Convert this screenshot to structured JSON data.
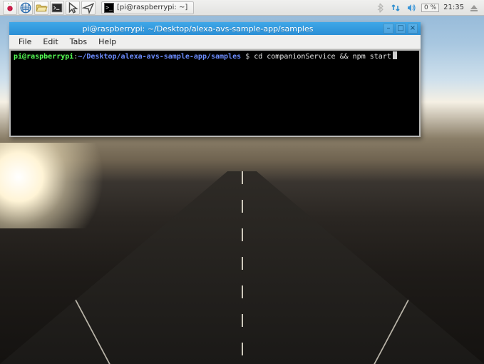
{
  "taskbar": {
    "task_label": "[pi@raspberrypi: ~]",
    "cpu_text": "0 %",
    "clock": "21:35"
  },
  "window": {
    "title": "pi@raspberrypi: ~/Desktop/alexa-avs-sample-app/samples",
    "menu": {
      "file": "File",
      "edit": "Edit",
      "tabs": "Tabs",
      "help": "Help"
    },
    "buttons": {
      "min": "–",
      "max": "□",
      "close": "×"
    }
  },
  "prompt": {
    "user": "pi",
    "at": "@",
    "host": "raspberrypi",
    "colon": ":",
    "path": "~/Desktop/alexa-avs-sample-app/samples",
    "symbol": " $",
    "command": " cd companionService && npm start"
  }
}
